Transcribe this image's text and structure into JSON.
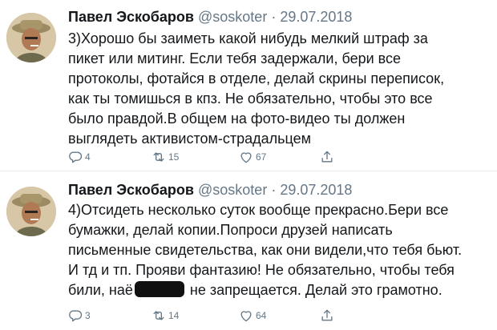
{
  "tweets": [
    {
      "author_name": "Павел Эскобаров",
      "handle": "@soskoter",
      "date": "29.07.2018",
      "text": "3)Хорошо бы заиметь какой нибудь мелкий штраф за\nпикет или митинг. Если тебя задержали, бери все\nпротоколы, фотайся в отделе, делай скрины переписок,\nкак ты томишься в кпз. Не обязательно, чтобы это все\nбыло правдой.В общем на фото-видео ты должен\nвыглядеть активистом-страдальцем",
      "replies": "4",
      "retweets": "15",
      "likes": "67"
    },
    {
      "author_name": "Павел Эскобаров",
      "handle": "@soskoter",
      "date": "29.07.2018",
      "text_before": "4)Отсидеть несколько суток вообще прекрасно.Бери все\nбумажки, делай копии.Попроси друзей написать\nписьменные свидетельства, как они видели,что тебя бьют.\nИ тд и тп. Прояви фантазию! Не обязательно, чтобы тебя\nбили, наё",
      "text_after": " не запрещается. Делай это грамотно.",
      "replies": "3",
      "retweets": "14",
      "likes": "64"
    }
  ],
  "icons": {
    "reply": "reply-icon",
    "retweet": "retweet-icon",
    "like": "heart-icon",
    "share": "share-icon"
  },
  "colors": {
    "name": "#14171a",
    "secondary": "#657786",
    "divider": "#e6ecf0"
  }
}
